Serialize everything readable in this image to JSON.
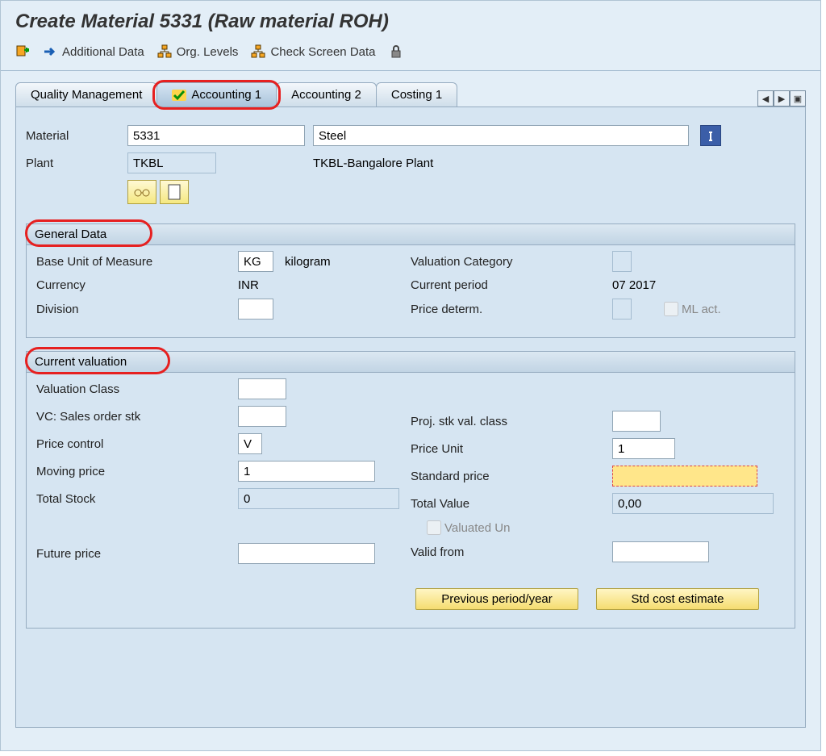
{
  "title": "Create Material 5331 (Raw material ROH)",
  "toolbar": {
    "additional_data": "Additional Data",
    "org_levels": "Org. Levels",
    "check_screen": "Check Screen Data"
  },
  "tabs": {
    "quality_mgmt": "Quality Management",
    "accounting1": "Accounting 1",
    "accounting2": "Accounting 2",
    "costing1": "Costing 1"
  },
  "header": {
    "material_label": "Material",
    "material_value": "5331",
    "material_desc": "Steel",
    "plant_label": "Plant",
    "plant_value": "TKBL",
    "plant_desc": "TKBL-Bangalore Plant"
  },
  "general": {
    "title": "General Data",
    "buom_label": "Base Unit of Measure",
    "buom_value": "KG",
    "buom_text": "kilogram",
    "currency_label": "Currency",
    "currency_value": "INR",
    "division_label": "Division",
    "valcat_label": "Valuation Category",
    "curper_label": "Current period",
    "curper_value": "07 2017",
    "pricedet_label": "Price determ.",
    "mlact_label": "ML act."
  },
  "valuation": {
    "title": "Current valuation",
    "valclass_label": "Valuation Class",
    "vc_sales_label": "VC: Sales order stk",
    "proj_stk_label": "Proj. stk val. class",
    "pricectrl_label": "Price control",
    "pricectrl_value": "V",
    "priceunit_label": "Price Unit",
    "priceunit_value": "1",
    "movprice_label": "Moving price",
    "movprice_value": "1",
    "stdprice_label": "Standard price",
    "stdprice_value": "",
    "totstock_label": "Total Stock",
    "totstock_value": "0",
    "totvalue_label": "Total Value",
    "totvalue_value": "0,00",
    "valun_label": "Valuated Un",
    "futprice_label": "Future price",
    "validfrom_label": "Valid from",
    "prev_period_btn": "Previous period/year",
    "std_cost_btn": "Std cost estimate"
  }
}
